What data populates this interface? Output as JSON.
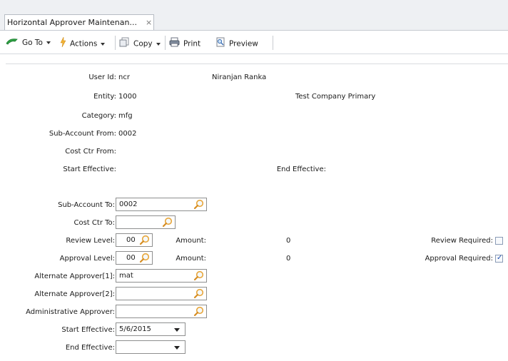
{
  "tab": {
    "title": "Horizontal Approver Maintenan...",
    "close_glyph": "×"
  },
  "toolbar": {
    "goto_label": "Go To",
    "actions_label": "Actions",
    "copy_label": "Copy",
    "print_label": "Print",
    "preview_label": "Preview"
  },
  "info": {
    "user_id_label": "User Id:",
    "user_id": "ncr",
    "user_name": "Niranjan Ranka",
    "entity_label": "Entity:",
    "entity": "1000",
    "entity_name": "Test Company Primary",
    "category_label": "Category:",
    "category": "mfg",
    "sub_account_from_label": "Sub-Account From:",
    "sub_account_from": "0002",
    "cost_ctr_from_label": "Cost Ctr From:",
    "cost_ctr_from": "",
    "start_effective_label": "Start Effective:",
    "start_effective": "",
    "end_effective_label": "End Effective:",
    "end_effective": ""
  },
  "form": {
    "sub_account_to_label": "Sub-Account To:",
    "sub_account_to": "0002",
    "cost_ctr_to_label": "Cost Ctr To:",
    "cost_ctr_to": "",
    "review_level_label": "Review Level:",
    "review_level": "00",
    "review_amount_label": "Amount:",
    "review_amount": "0",
    "review_required_label": "Review Required:",
    "review_required": false,
    "approval_level_label": "Approval Level:",
    "approval_level": "00",
    "approval_amount_label": "Amount:",
    "approval_amount": "0",
    "approval_required_label": "Approval Required:",
    "approval_required": true,
    "alt_approver1_label": "Alternate Approver[1]:",
    "alt_approver1": "mat",
    "alt_approver2_label": "Alternate Approver[2]:",
    "alt_approver2": "",
    "admin_approver_label": "Administrative Approver:",
    "admin_approver": "",
    "start_effective_label": "Start Effective:",
    "start_effective": "5/6/2015",
    "end_effective_label": "End Effective:",
    "end_effective": ""
  },
  "icons": {
    "goto": "green-arrow-icon",
    "actions": "lightning-icon",
    "copy": "copy-icon",
    "print": "printer-icon",
    "preview": "preview-icon",
    "lookup": "magnifier-icon",
    "dropdown": "chevron-down-icon",
    "checkmark": "checkmark-icon"
  },
  "colors": {
    "tab_bar": "#eef0f3",
    "lookup_icon": "#e8a63a",
    "check_mark": "#1f4fb0"
  }
}
